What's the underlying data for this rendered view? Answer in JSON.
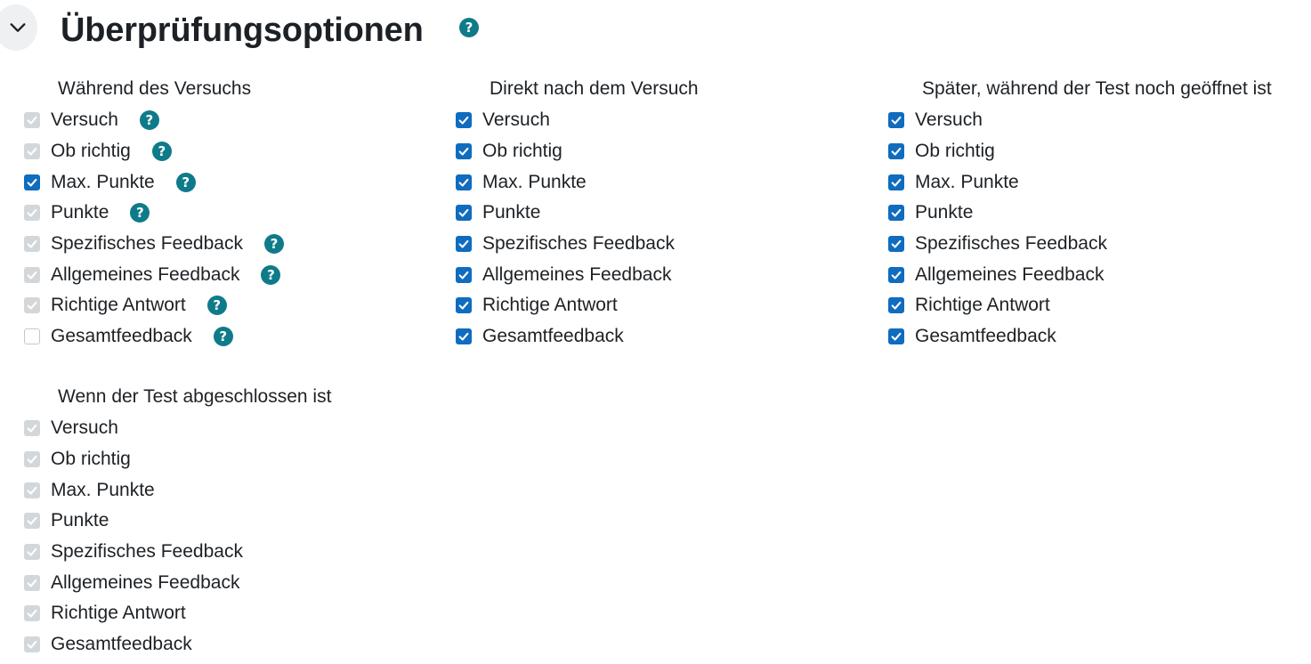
{
  "section": {
    "title": "Überprüfungsoptionen",
    "help_glyph": "?"
  },
  "groups": [
    {
      "heading": "Während des Versuchs",
      "options": [
        {
          "label": "Versuch",
          "state": "disabled",
          "help": true
        },
        {
          "label": "Ob richtig",
          "state": "disabled",
          "help": true
        },
        {
          "label": "Max. Punkte",
          "state": "checked",
          "help": true
        },
        {
          "label": "Punkte",
          "state": "disabled",
          "help": true
        },
        {
          "label": "Spezifisches Feedback",
          "state": "disabled",
          "help": true
        },
        {
          "label": "Allgemeines Feedback",
          "state": "disabled",
          "help": true
        },
        {
          "label": "Richtige Antwort",
          "state": "disabled",
          "help": true
        },
        {
          "label": "Gesamtfeedback",
          "state": "unchecked",
          "help": true
        }
      ]
    },
    {
      "heading": "Direkt nach dem Versuch",
      "options": [
        {
          "label": "Versuch",
          "state": "checked"
        },
        {
          "label": "Ob richtig",
          "state": "checked"
        },
        {
          "label": "Max. Punkte",
          "state": "checked"
        },
        {
          "label": "Punkte",
          "state": "checked"
        },
        {
          "label": "Spezifisches Feedback",
          "state": "checked"
        },
        {
          "label": "Allgemeines Feedback",
          "state": "checked"
        },
        {
          "label": "Richtige Antwort",
          "state": "checked"
        },
        {
          "label": "Gesamtfeedback",
          "state": "checked"
        }
      ]
    },
    {
      "heading": "Später, während der Test noch geöffnet ist",
      "options": [
        {
          "label": "Versuch",
          "state": "checked"
        },
        {
          "label": "Ob richtig",
          "state": "checked"
        },
        {
          "label": "Max. Punkte",
          "state": "checked"
        },
        {
          "label": "Punkte",
          "state": "checked"
        },
        {
          "label": "Spezifisches Feedback",
          "state": "checked"
        },
        {
          "label": "Allgemeines Feedback",
          "state": "checked"
        },
        {
          "label": "Richtige Antwort",
          "state": "checked"
        },
        {
          "label": "Gesamtfeedback",
          "state": "checked"
        }
      ]
    },
    {
      "heading": "Wenn der Test abgeschlossen ist",
      "options": [
        {
          "label": "Versuch",
          "state": "disabled"
        },
        {
          "label": "Ob richtig",
          "state": "disabled"
        },
        {
          "label": "Max. Punkte",
          "state": "disabled"
        },
        {
          "label": "Punkte",
          "state": "disabled"
        },
        {
          "label": "Spezifisches Feedback",
          "state": "disabled"
        },
        {
          "label": "Allgemeines Feedback",
          "state": "disabled"
        },
        {
          "label": "Richtige Antwort",
          "state": "disabled"
        },
        {
          "label": "Gesamtfeedback",
          "state": "disabled"
        }
      ]
    }
  ],
  "colors": {
    "checkbox_checked": "#0f6cbf",
    "checkbox_disabled": "#d4d7da",
    "help_icon": "#0f7b8a"
  },
  "icons": {
    "collapse": "chevron-down-icon",
    "help": "question-circle-icon",
    "check": "checkmark-icon"
  }
}
